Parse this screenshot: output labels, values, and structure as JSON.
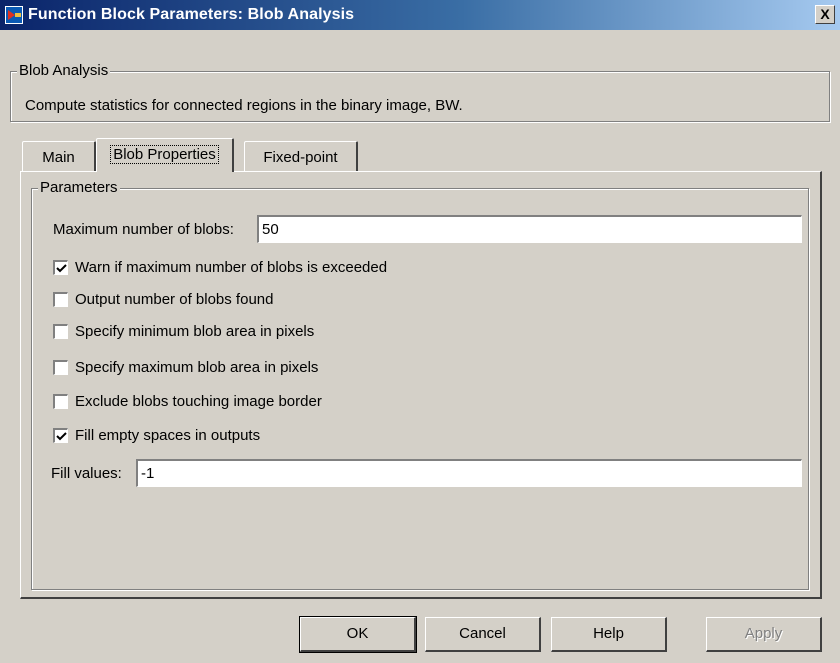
{
  "window": {
    "title": "Function Block Parameters: Blob Analysis",
    "close_label": "X"
  },
  "header_group": {
    "legend": "Blob Analysis",
    "description": "Compute statistics for connected regions in the binary image, BW."
  },
  "tabs": [
    {
      "label": "Main",
      "active": false
    },
    {
      "label": "Blob Properties",
      "active": true
    },
    {
      "label": "Fixed-point",
      "active": false
    }
  ],
  "parameters": {
    "legend": "Parameters",
    "max_blobs_label": "Maximum number of blobs:",
    "max_blobs_value": "50",
    "checkboxes": [
      {
        "label": "Warn if maximum number of blobs is exceeded",
        "checked": true
      },
      {
        "label": "Output number of blobs found",
        "checked": false
      },
      {
        "label": "Specify minimum blob area in pixels",
        "checked": false
      },
      {
        "label": "Specify maximum blob area in pixels",
        "checked": false
      },
      {
        "label": "Exclude blobs touching image border",
        "checked": false
      },
      {
        "label": "Fill empty spaces in outputs",
        "checked": true
      }
    ],
    "fill_values_label": "Fill values:",
    "fill_values_value": "-1"
  },
  "buttons": {
    "ok": "OK",
    "cancel": "Cancel",
    "help": "Help",
    "apply": "Apply"
  }
}
